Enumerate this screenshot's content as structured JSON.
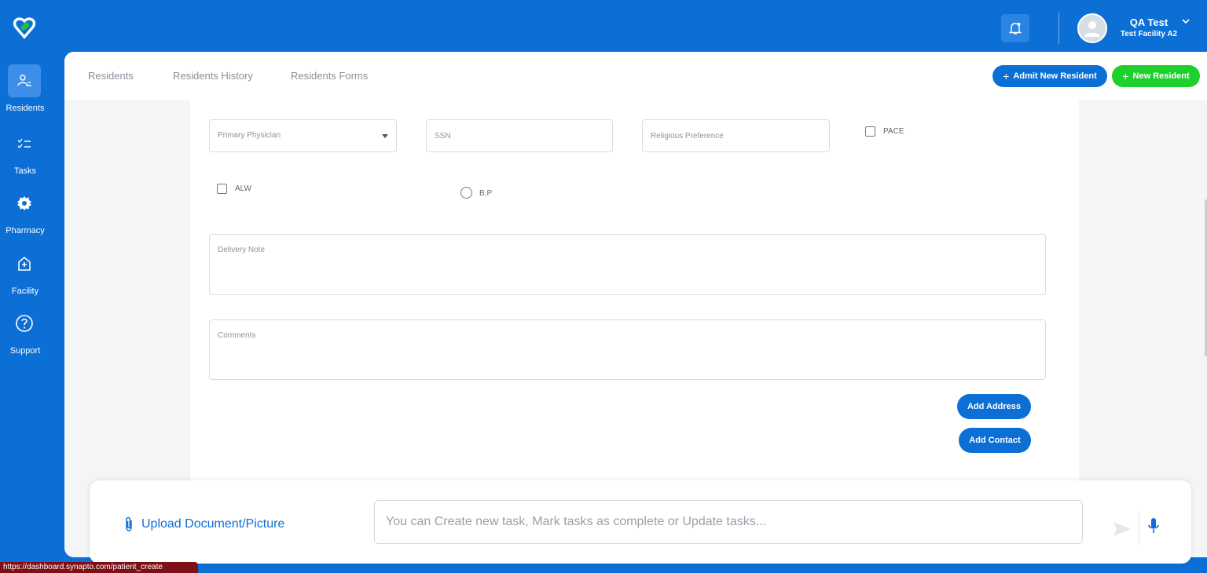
{
  "header": {
    "user_name": "QA Test",
    "facility": "Test Facility A2"
  },
  "sidebar": {
    "items": [
      {
        "label": "Residents",
        "icon": "residents-icon",
        "active": true
      },
      {
        "label": "Tasks",
        "icon": "tasks-icon",
        "active": false
      },
      {
        "label": "Pharmacy",
        "icon": "gear-icon",
        "active": false
      },
      {
        "label": "Facility",
        "icon": "facility-icon",
        "active": false
      },
      {
        "label": "Support",
        "icon": "help-icon",
        "active": false
      }
    ]
  },
  "tabs": [
    {
      "label": "Residents"
    },
    {
      "label": "Residents History"
    },
    {
      "label": "Residents Forms"
    }
  ],
  "actions": {
    "admit_label": "Admit New Resident",
    "new_label": "New Resident"
  },
  "form": {
    "primary_physician_placeholder": "Primary Physician",
    "ssn_placeholder": "SSN",
    "religious_placeholder": "Religious Preference",
    "pace_label": "PACE",
    "alw_label": "ALW",
    "bp_label": "B.P",
    "delivery_note_placeholder": "Delivery Note",
    "comments_placeholder": "Comments",
    "add_address_label": "Add Address",
    "add_contact_label": "Add Contact"
  },
  "chat": {
    "upload_label": "Upload Document/Picture",
    "input_placeholder": "You can Create new task, Mark tasks as complete or Update tasks..."
  },
  "status_url": "https://dashboard.synapto.com/patient_create",
  "colors": {
    "brand_blue": "#0b6fd6",
    "accent_green": "#1ed02c",
    "status_red": "#7d0f16"
  }
}
